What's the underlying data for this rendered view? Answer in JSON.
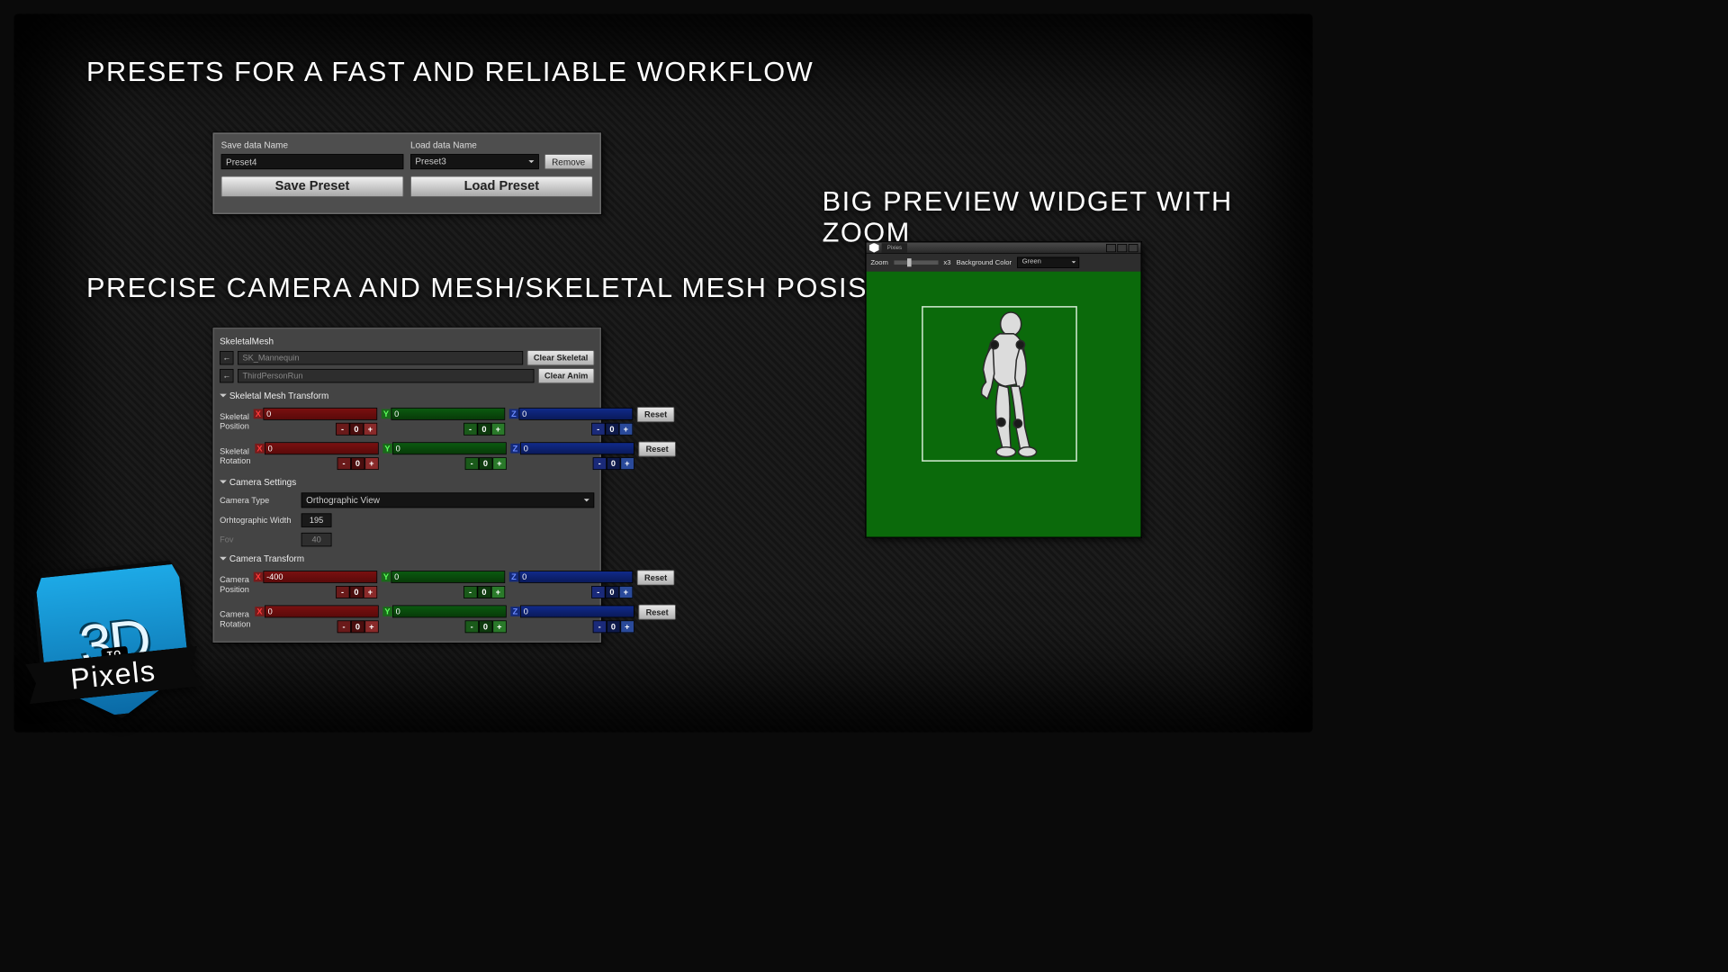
{
  "headings": {
    "h1": "PRESETS FOR A FAST AND RELIABLE WORKFLOW",
    "h2": "PRECISE CAMERA AND MESH/SKELETAL MESH POSISITION",
    "h3": "BIG PREVIEW WIDGET WITH ZOOM"
  },
  "preset": {
    "save_label": "Save data Name",
    "save_value": "Preset4",
    "load_label": "Load data Name",
    "load_value": "Preset3",
    "remove_btn": "Remove",
    "save_btn": "Save Preset",
    "load_btn": "Load Preset"
  },
  "tf": {
    "title": "SkeletalMesh",
    "mesh_value": "SK_Mannequin",
    "anim_value": "ThirdPersonRun",
    "clear_skeletal": "Clear Skeletal",
    "clear_anim": "Clear Anim",
    "sec_transform": "Skeletal Mesh Transform",
    "skel_pos_label": "Skeletal Position",
    "skel_rot_label": "Skeletal Rotation",
    "sec_camera": "Camera Settings",
    "cam_type_label": "Camera Type",
    "cam_type_value": "Orthographic View",
    "ortho_label": "Orhtographic Width",
    "ortho_value": "195",
    "fov_label": "Fov",
    "fov_value": "40",
    "sec_camtf": "Camera Transform",
    "cam_pos_label": "Camera Position",
    "cam_rot_label": "Camera Rotation",
    "reset": "Reset",
    "vals": {
      "skel_pos": {
        "x": "0",
        "y": "0",
        "z": "0"
      },
      "skel_rot": {
        "x": "0",
        "y": "0",
        "z": "0"
      },
      "cam_pos": {
        "x": "-400",
        "y": "0",
        "z": "0"
      },
      "cam_rot": {
        "x": "0",
        "y": "0",
        "z": "0"
      }
    },
    "step_zero": "0"
  },
  "preview": {
    "tab": "Pixies",
    "zoom_label": "Zoom",
    "zoom_mult": "x3",
    "bg_label": "Background Color",
    "bg_value": "Green"
  },
  "logo": {
    "top": "3D",
    "to": "TO",
    "bottom": "Pixels"
  }
}
